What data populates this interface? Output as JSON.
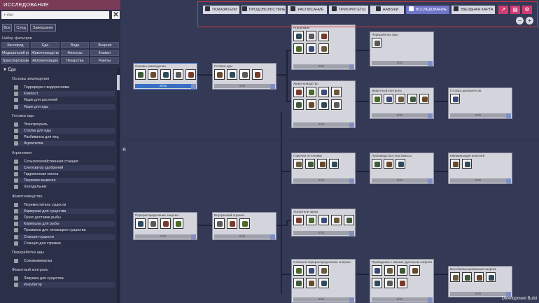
{
  "left_panel": {
    "title": "ИССЛЕДОВАНИЕ",
    "filter_placeholder": "Filter",
    "clear_label": "✕",
    "segments": [
      "Все",
      "След",
      "Завершено"
    ],
    "filter_set_label": "Набор фильтров",
    "filter_chips": [
      [
        "Кислород",
        "Еда",
        "Вода",
        "Энергия"
      ],
      [
        "Медицинский рост",
        "Животноводство",
        "Фильтры",
        "Климат"
      ],
      [
        "Транспортировка",
        "Автоматизация",
        "Лекарства",
        "Ракеты"
      ]
    ],
    "tree": [
      {
        "type": "cat",
        "label": "▼ Еда"
      },
      {
        "type": "sub",
        "label": "Основы земледелия"
      },
      {
        "type": "item",
        "label": "Террариум с водорослями"
      },
      {
        "type": "item",
        "label": "Компост"
      },
      {
        "type": "item",
        "label": "Ящик для растений"
      },
      {
        "type": "item",
        "label": "Ящик для еды"
      },
      {
        "type": "sub",
        "label": "Готовка еды"
      },
      {
        "type": "item",
        "label": "Электрогриль"
      },
      {
        "type": "item",
        "label": "Столик для еды"
      },
      {
        "type": "item",
        "label": "Разбивалка для яиц"
      },
      {
        "type": "item",
        "label": "Агроклетка"
      },
      {
        "type": "sub",
        "label": "Агрономия"
      },
      {
        "type": "item",
        "label": "Сельскохозяйственная станция"
      },
      {
        "type": "item",
        "label": "Синтезатор удобрений"
      },
      {
        "type": "item",
        "label": "Гидропонная клетка"
      },
      {
        "type": "item",
        "label": "Парковая вывеска"
      },
      {
        "type": "item",
        "label": "Холодильник"
      },
      {
        "type": "sub",
        "label": "Животноводство"
      },
      {
        "type": "item",
        "label": "Переместитель существ"
      },
      {
        "type": "item",
        "label": "Кормушка для существа"
      },
      {
        "type": "item",
        "label": "Пункт доставки рыбы"
      },
      {
        "type": "item",
        "label": "Кормушка для рыбы"
      },
      {
        "type": "item",
        "label": "Приманка для летающего существа"
      },
      {
        "type": "item",
        "label": "Станция существ"
      },
      {
        "type": "item",
        "label": "Станция для стрижки"
      },
      {
        "type": "sub",
        "label": "Переработка еды"
      },
      {
        "type": "item",
        "label": "Соковыжималка"
      },
      {
        "type": "sub",
        "label": "Животный контроль"
      },
      {
        "type": "item",
        "label": "Ловушка для существа"
      },
      {
        "type": "item",
        "label": "Инкубатор"
      }
    ]
  },
  "toolbar": {
    "buttons": [
      {
        "label": "ПОКАЗАТЕЛИ",
        "icon": "heart-icon"
      },
      {
        "label": "ПРОДОВОЛЬСТВИЕ",
        "icon": "food-icon"
      },
      {
        "label": "РАСПИСАНИЕ",
        "icon": "clock-icon"
      },
      {
        "label": "ПРИОРИТЕТЫ",
        "icon": "priority-icon"
      },
      {
        "label": "НАВЫКИ",
        "icon": "wrench-icon"
      },
      {
        "label": "ИССЛЕДОВАНИЕ",
        "icon": "research-icon",
        "active": true
      },
      {
        "label": "ЗВЕЗДНАЯ КАРТА",
        "icon": "rocket-icon"
      }
    ],
    "extra_icons": [
      "chart-icon",
      "book-icon",
      "gear-icon"
    ],
    "zoom_out": "−",
    "zoom_in": "+"
  },
  "nodes": [
    {
      "title": "Основы земледелия",
      "progress": "20/20",
      "done": true
    },
    {
      "title": "Готовка еды",
      "progress": "0/30"
    },
    {
      "title": "Агрономия",
      "progress": "0/30"
    },
    {
      "title": "Переработка еды",
      "progress": "0/30"
    },
    {
      "title": "Животноводство",
      "progress": "0/30"
    },
    {
      "title": "Животный контроль",
      "progress": "0/30"
    },
    {
      "title": "Готовка деликатесов",
      "progress": "0/30"
    },
    {
      "title": "Горючие источники",
      "progress": "0/30"
    },
    {
      "title": "Производство пластмассы",
      "progress": "0/30"
    },
    {
      "title": "Минимизация вонючей",
      "progress": "0/30"
    },
    {
      "title": "Перераспределение энергии",
      "progress": "0/30"
    },
    {
      "title": "Внутренний огранич",
      "progress": "0/30"
    },
    {
      "title": "Усилители звука",
      "progress": "0/30"
    },
    {
      "title": "Сложное перераспределение энергии",
      "progress": "0/30"
    },
    {
      "title": "Проводники с малым удельным сопротивлением",
      "progress": "0/30"
    },
    {
      "title": "Всесбалансированная энергия",
      "progress": "0/30"
    }
  ],
  "footer": {
    "dev_build": "Development Build"
  },
  "colors": {
    "accent": "#6f76c8",
    "header": "#7a3b57",
    "highlight": "#d6353c",
    "bg": "#343a56"
  }
}
